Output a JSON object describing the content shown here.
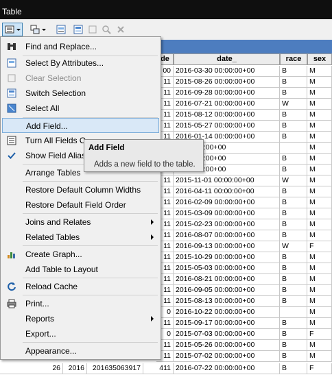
{
  "window": {
    "title": "Table"
  },
  "toolbar": {
    "buttons": [
      {
        "icon": "table-options-icon"
      },
      {
        "icon": "related-tables-icon"
      },
      {
        "icon": "select-by-attributes-icon"
      },
      {
        "icon": "switch-selection-icon"
      },
      {
        "icon": "clear-selection-icon"
      },
      {
        "icon": "zoom-to-selected-icon"
      },
      {
        "icon": "delete-selected-icon"
      }
    ]
  },
  "table": {
    "columns": [
      "de",
      "date_",
      "race",
      "sex"
    ],
    "rows": [
      {
        "de": "00",
        "date": "2016-03-30 00:00:00+00",
        "race": "B",
        "sex": "M"
      },
      {
        "de": "11",
        "date": "2015-08-26 00:00:00+00",
        "race": "B",
        "sex": "M"
      },
      {
        "de": "11",
        "date": "2016-09-28 00:00:00+00",
        "race": "B",
        "sex": "M"
      },
      {
        "de": "11",
        "date": "2016-07-21 00:00:00+00",
        "race": "W",
        "sex": "M"
      },
      {
        "de": "11",
        "date": "2015-08-12 00:00:00+00",
        "race": "B",
        "sex": "M"
      },
      {
        "de": "11",
        "date": "2015-05-27 00:00:00+00",
        "race": "B",
        "sex": "M"
      },
      {
        "de": "11",
        "date": "2016-01-14 00:00:00+00",
        "race": "B",
        "sex": "M"
      },
      {
        "de": "",
        "date": "22 00:00:00+00",
        "race": "",
        "sex": "M"
      },
      {
        "de": "",
        "date": "19 00:00:00+00",
        "race": "B",
        "sex": "M"
      },
      {
        "de": "",
        "date": "14 00:00:00+00",
        "race": "B",
        "sex": "M"
      },
      {
        "de": "11",
        "date": "2015-11-01 00:00:00+00",
        "race": "W",
        "sex": "M"
      },
      {
        "de": "11",
        "date": "2016-04-11 00:00:00+00",
        "race": "B",
        "sex": "M"
      },
      {
        "de": "11",
        "date": "2016-02-09 00:00:00+00",
        "race": "B",
        "sex": "M"
      },
      {
        "de": "11",
        "date": "2015-03-09 00:00:00+00",
        "race": "B",
        "sex": "M"
      },
      {
        "de": "11",
        "date": "2015-02-23 00:00:00+00",
        "race": "B",
        "sex": "M"
      },
      {
        "de": "11",
        "date": "2016-08-07 00:00:00+00",
        "race": "B",
        "sex": "M"
      },
      {
        "de": "11",
        "date": "2016-09-13 00:00:00+00",
        "race": "W",
        "sex": "F"
      },
      {
        "de": "11",
        "date": "2015-10-29 00:00:00+00",
        "race": "B",
        "sex": "M"
      },
      {
        "de": "11",
        "date": "2015-05-03 00:00:00+00",
        "race": "B",
        "sex": "M"
      },
      {
        "de": "11",
        "date": "2016-08-21 00:00:00+00",
        "race": "B",
        "sex": "M"
      },
      {
        "de": "11",
        "date": "2016-09-05 00:00:00+00",
        "race": "B",
        "sex": "M"
      },
      {
        "de": "11",
        "date": "2015-08-13 00:00:00+00",
        "race": "B",
        "sex": "M"
      },
      {
        "de": "0",
        "date": "2016-10-22 00:00:00+00",
        "race": "",
        "sex": "M"
      },
      {
        "de": "11",
        "date": "2015-09-17 00:00:00+00",
        "race": "B",
        "sex": "M"
      },
      {
        "de": "0",
        "date": "2015-07-03 00:00:00+00",
        "race": "B",
        "sex": "F"
      },
      {
        "de": "11",
        "date": "2015-05-26 00:00:00+00",
        "race": "B",
        "sex": "M"
      },
      {
        "de": "11",
        "date": "2015-07-02 00:00:00+00",
        "race": "B",
        "sex": "M"
      }
    ],
    "last_row": {
      "a": "26",
      "b": "2016",
      "c": "201635063917",
      "d": "411",
      "date": "2016-07-22 00:00:00+00",
      "race": "B",
      "sex": "F"
    }
  },
  "menu": {
    "items": [
      {
        "label": "Find and Replace...",
        "icon": "binoculars-icon"
      },
      {
        "label": "Select By Attributes...",
        "icon": "select-by-attributes-icon"
      },
      {
        "label": "Clear Selection",
        "icon": "clear-selection-icon",
        "disabled": true
      },
      {
        "label": "Switch Selection",
        "icon": "switch-selection-icon"
      },
      {
        "label": "Select All",
        "icon": "select-all-icon"
      },
      {
        "label": "Add Field...",
        "highlighted": true
      },
      {
        "label": "Turn All Fields O",
        "icon": "turn-fields-icon"
      },
      {
        "label": "Show Field Aliase",
        "icon": "checkmark-icon"
      },
      {
        "label": "Arrange Tables",
        "submenu": true
      },
      {
        "label": "Restore Default Column Widths"
      },
      {
        "label": "Restore Default Field Order"
      },
      {
        "label": "Joins and Relates",
        "submenu": true
      },
      {
        "label": "Related Tables",
        "submenu": true
      },
      {
        "label": "Create Graph...",
        "icon": "bar-chart-icon"
      },
      {
        "label": "Add Table to Layout"
      },
      {
        "label": "Reload Cache",
        "icon": "reload-icon"
      },
      {
        "label": "Print...",
        "icon": "printer-icon"
      },
      {
        "label": "Reports",
        "submenu": true
      },
      {
        "label": "Export..."
      },
      {
        "label": "Appearance..."
      }
    ]
  },
  "tooltip": {
    "title": "Add Field",
    "description": "Adds a new field to the table."
  },
  "colors": {
    "accent": "#4d7dbf",
    "highlight": "#d9e8f7",
    "titlebar": "#0f0f0f"
  }
}
